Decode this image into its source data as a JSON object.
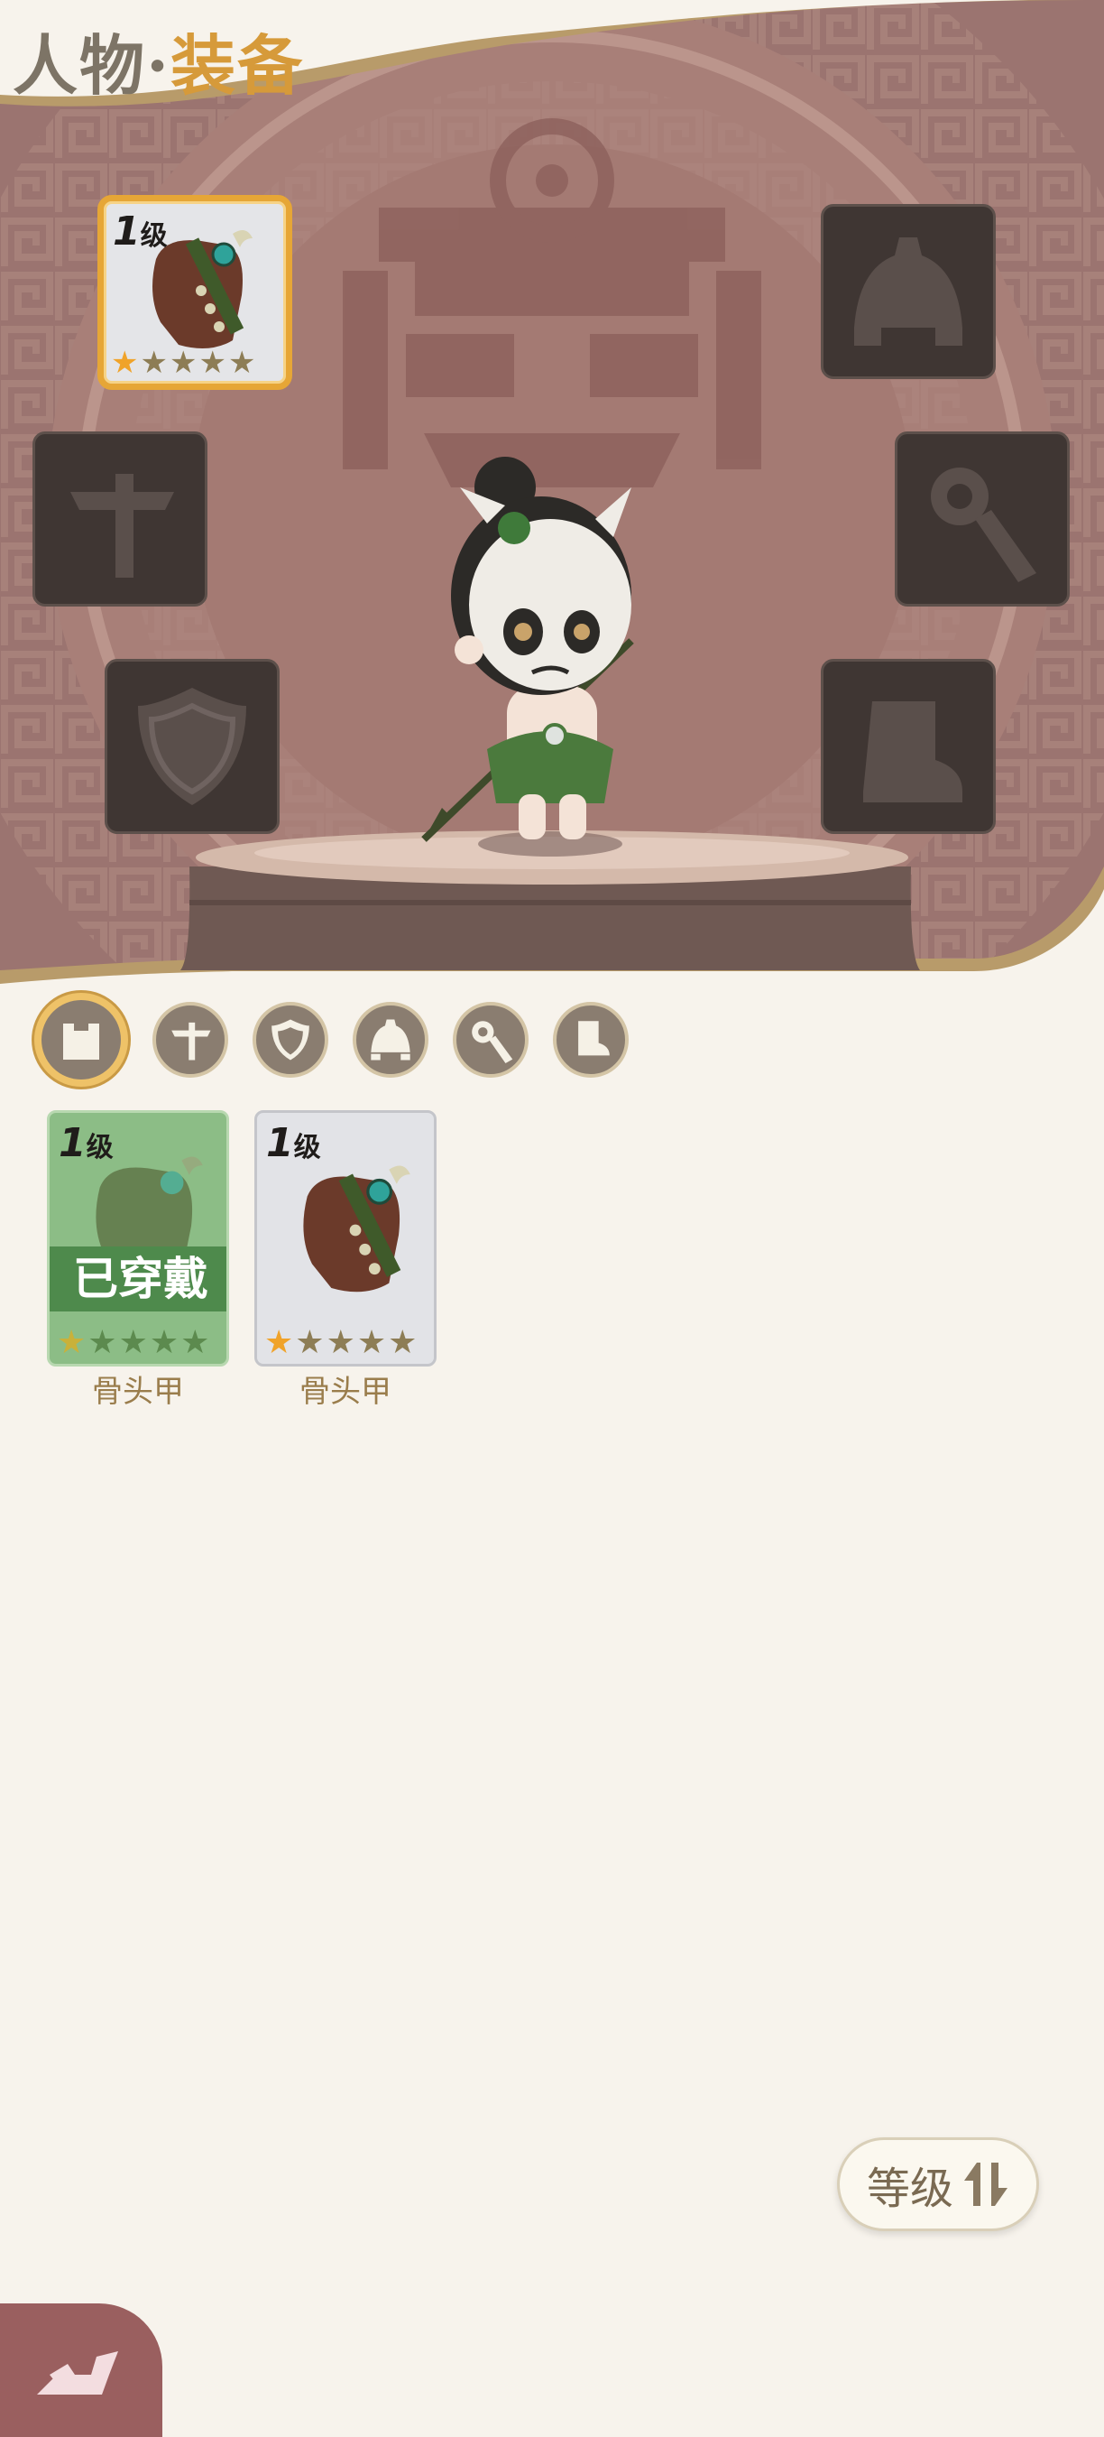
{
  "header": {
    "title_part1": "人物",
    "title_sep": "·",
    "title_part2": "装备"
  },
  "slots": {
    "armor": {
      "level_num": "1",
      "level_unit": "级",
      "stars_total": 5,
      "stars_filled": 1
    },
    "helmet_icon": "helmet-icon",
    "weapon_icon": "weapon-icon",
    "tool_icon": "wrench-icon",
    "shield_icon": "shield-icon",
    "boots_icon": "boot-icon"
  },
  "tabs": [
    {
      "name": "armor",
      "icon": "armor-icon",
      "active": true
    },
    {
      "name": "weapon",
      "icon": "weapon-icon",
      "active": false
    },
    {
      "name": "shield",
      "icon": "shield-icon",
      "active": false
    },
    {
      "name": "helmet",
      "icon": "helmet-icon",
      "active": false
    },
    {
      "name": "tool",
      "icon": "wrench-icon",
      "active": false
    },
    {
      "name": "boots",
      "icon": "boot-icon",
      "active": false
    }
  ],
  "inventory": [
    {
      "level_num": "1",
      "level_unit": "级",
      "name": "骨头甲",
      "equipped_label": "已穿戴",
      "stars_filled": 1,
      "stars_total": 5
    },
    {
      "level_num": "1",
      "level_unit": "级",
      "name": "骨头甲",
      "stars_filled": 1,
      "stars_total": 5
    }
  ],
  "sort": {
    "label": "等级",
    "icon": "sort-arrows-icon"
  },
  "back": {
    "icon": "back-arrow-icon"
  },
  "colors": {
    "accent": "#e6a636",
    "title_gold": "#d69a3a",
    "slot_bg": "#3f3633",
    "equipped_green": "#4e8a4c"
  }
}
